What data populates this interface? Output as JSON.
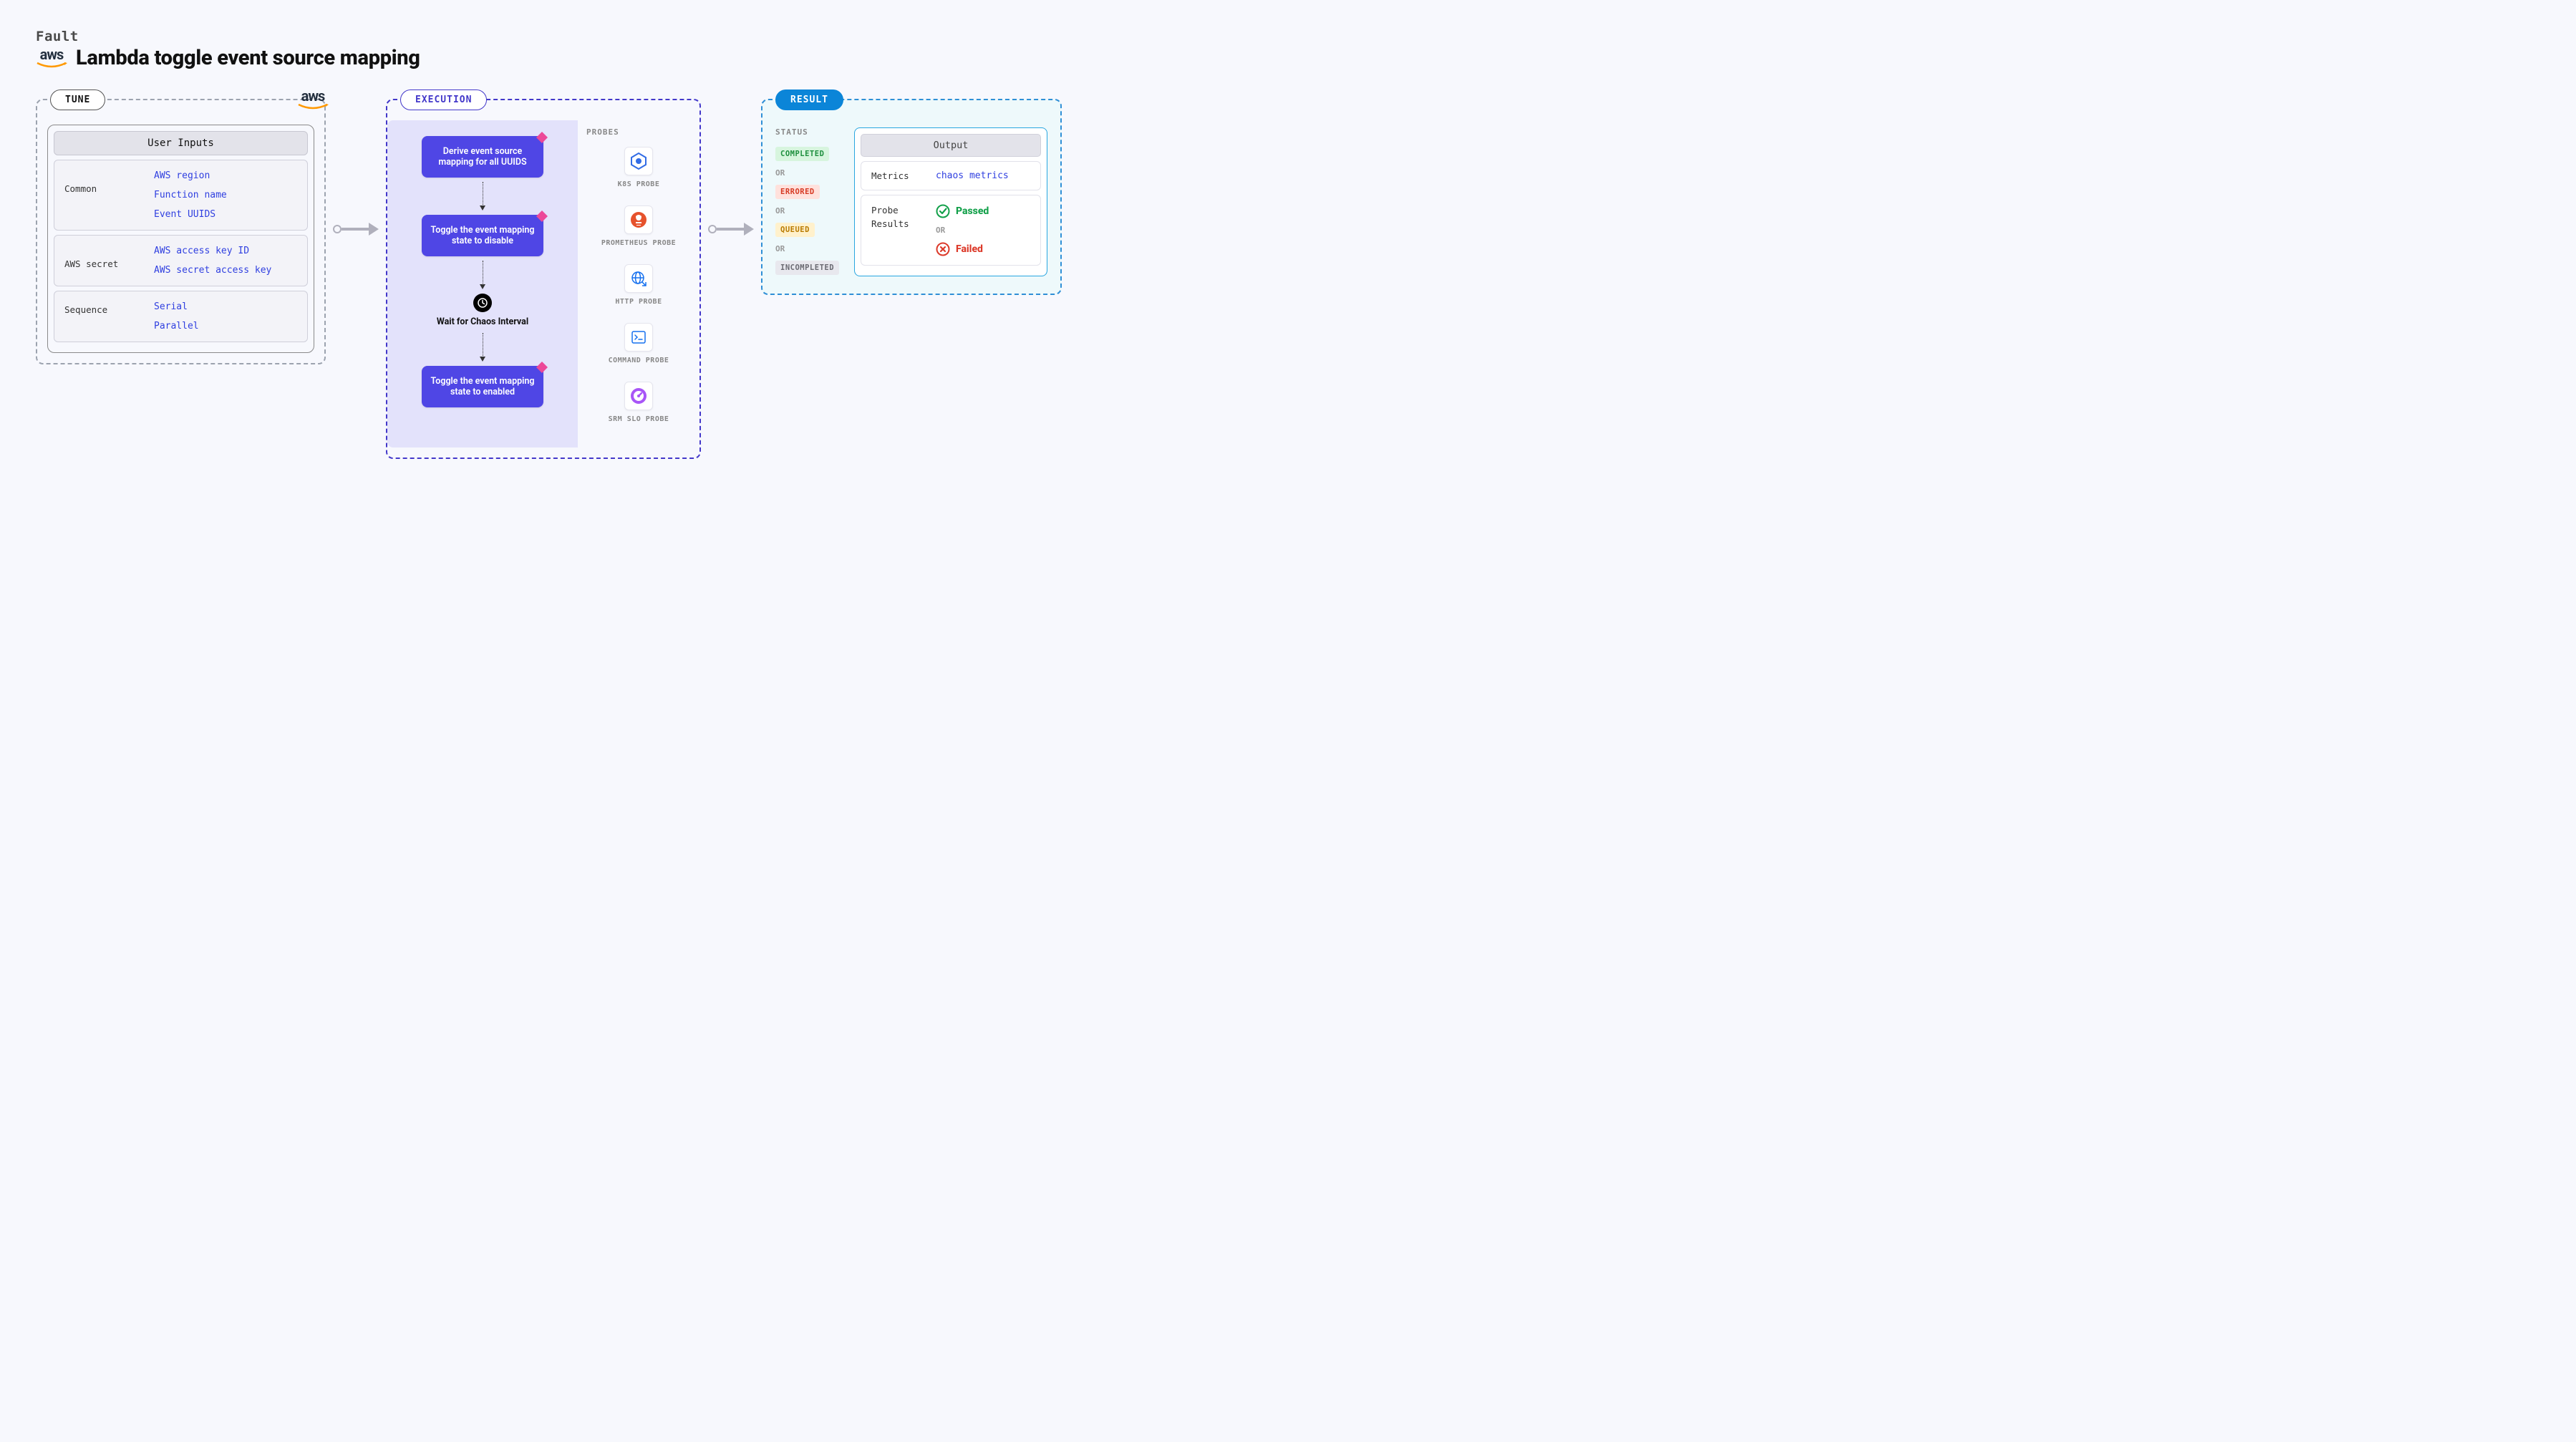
{
  "header": {
    "fault_label": "Fault",
    "aws_text": "aws",
    "page_title": "Lambda toggle event source mapping"
  },
  "tune": {
    "tab": "TUNE",
    "aws_text": "aws",
    "inputs_header": "User Inputs",
    "groups": [
      {
        "name": "Common",
        "values": [
          "AWS region",
          "Function name",
          "Event UUIDS"
        ]
      },
      {
        "name": "AWS secret",
        "values": [
          "AWS access key ID",
          "AWS secret access key"
        ]
      },
      {
        "name": "Sequence",
        "values": [
          "Serial",
          "Parallel"
        ]
      }
    ]
  },
  "execution": {
    "tab": "EXECUTION",
    "steps": [
      "Derive event source mapping for all UUIDS",
      "Toggle the event mapping state to disable",
      "Toggle the event mapping state to enabled"
    ],
    "wait_label": "Wait for Chaos Interval",
    "probes_label": "PROBES",
    "probes": [
      {
        "label": "K8S PROBE",
        "icon": "k8s"
      },
      {
        "label": "PROMETHEUS PROBE",
        "icon": "prom"
      },
      {
        "label": "HTTP PROBE",
        "icon": "http"
      },
      {
        "label": "COMMAND PROBE",
        "icon": "cmd"
      },
      {
        "label": "SRM SLO PROBE",
        "icon": "slo"
      }
    ]
  },
  "result": {
    "tab": "RESULT",
    "status_label": "STATUS",
    "statuses": [
      "COMPLETED",
      "ERRORED",
      "QUEUED",
      "INCOMPLETED"
    ],
    "or": "OR",
    "output_header": "Output",
    "metrics_label": "Metrics",
    "metrics_link": "chaos metrics",
    "probe_results_label": "Probe Results",
    "passed": "Passed",
    "failed": "Failed"
  }
}
